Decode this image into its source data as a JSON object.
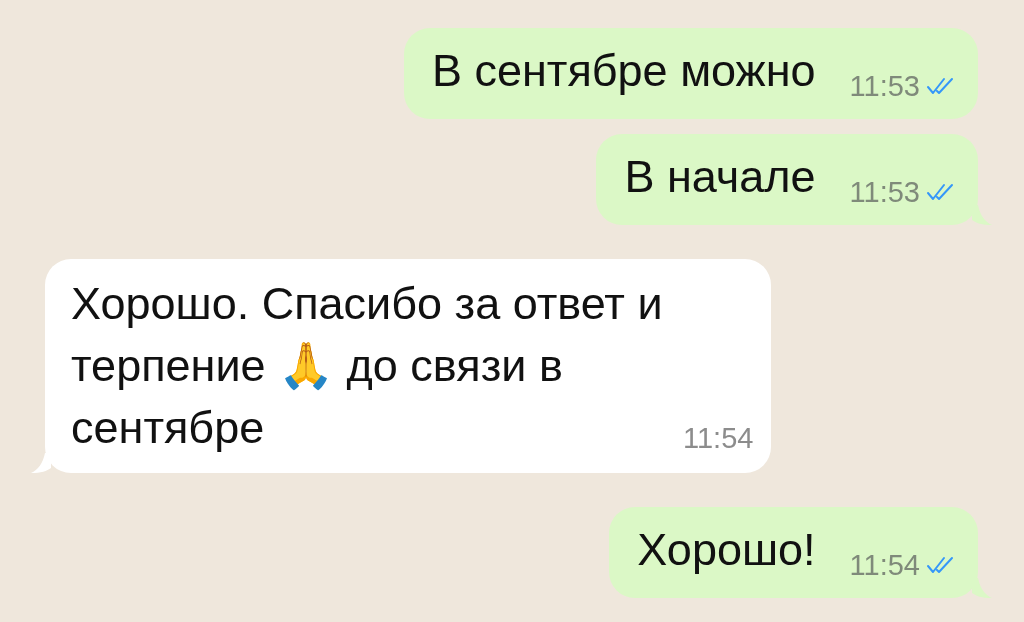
{
  "messages": [
    {
      "kind": "outgoing",
      "text": "В сентябре можно",
      "time": "11:53",
      "read": true
    },
    {
      "kind": "outgoing",
      "text": "В начале",
      "time": "11:53",
      "read": true
    },
    {
      "kind": "incoming",
      "text": "Хорошо. Спасибо за ответ и терпение 🙏 до связи в сентябре",
      "time": "11:54"
    },
    {
      "kind": "outgoing",
      "text": "Хорошо!",
      "time": "11:54",
      "read": true
    }
  ]
}
